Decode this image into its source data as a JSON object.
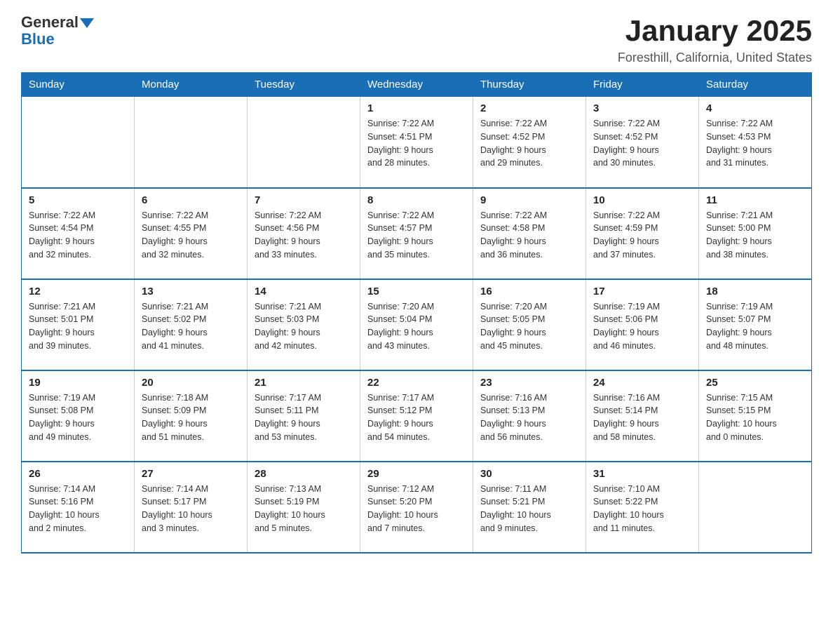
{
  "header": {
    "logo_general": "General",
    "logo_blue": "Blue",
    "month_title": "January 2025",
    "location": "Foresthill, California, United States"
  },
  "days_of_week": [
    "Sunday",
    "Monday",
    "Tuesday",
    "Wednesday",
    "Thursday",
    "Friday",
    "Saturday"
  ],
  "weeks": [
    [
      {
        "day": "",
        "info": ""
      },
      {
        "day": "",
        "info": ""
      },
      {
        "day": "",
        "info": ""
      },
      {
        "day": "1",
        "info": "Sunrise: 7:22 AM\nSunset: 4:51 PM\nDaylight: 9 hours\nand 28 minutes."
      },
      {
        "day": "2",
        "info": "Sunrise: 7:22 AM\nSunset: 4:52 PM\nDaylight: 9 hours\nand 29 minutes."
      },
      {
        "day": "3",
        "info": "Sunrise: 7:22 AM\nSunset: 4:52 PM\nDaylight: 9 hours\nand 30 minutes."
      },
      {
        "day": "4",
        "info": "Sunrise: 7:22 AM\nSunset: 4:53 PM\nDaylight: 9 hours\nand 31 minutes."
      }
    ],
    [
      {
        "day": "5",
        "info": "Sunrise: 7:22 AM\nSunset: 4:54 PM\nDaylight: 9 hours\nand 32 minutes."
      },
      {
        "day": "6",
        "info": "Sunrise: 7:22 AM\nSunset: 4:55 PM\nDaylight: 9 hours\nand 32 minutes."
      },
      {
        "day": "7",
        "info": "Sunrise: 7:22 AM\nSunset: 4:56 PM\nDaylight: 9 hours\nand 33 minutes."
      },
      {
        "day": "8",
        "info": "Sunrise: 7:22 AM\nSunset: 4:57 PM\nDaylight: 9 hours\nand 35 minutes."
      },
      {
        "day": "9",
        "info": "Sunrise: 7:22 AM\nSunset: 4:58 PM\nDaylight: 9 hours\nand 36 minutes."
      },
      {
        "day": "10",
        "info": "Sunrise: 7:22 AM\nSunset: 4:59 PM\nDaylight: 9 hours\nand 37 minutes."
      },
      {
        "day": "11",
        "info": "Sunrise: 7:21 AM\nSunset: 5:00 PM\nDaylight: 9 hours\nand 38 minutes."
      }
    ],
    [
      {
        "day": "12",
        "info": "Sunrise: 7:21 AM\nSunset: 5:01 PM\nDaylight: 9 hours\nand 39 minutes."
      },
      {
        "day": "13",
        "info": "Sunrise: 7:21 AM\nSunset: 5:02 PM\nDaylight: 9 hours\nand 41 minutes."
      },
      {
        "day": "14",
        "info": "Sunrise: 7:21 AM\nSunset: 5:03 PM\nDaylight: 9 hours\nand 42 minutes."
      },
      {
        "day": "15",
        "info": "Sunrise: 7:20 AM\nSunset: 5:04 PM\nDaylight: 9 hours\nand 43 minutes."
      },
      {
        "day": "16",
        "info": "Sunrise: 7:20 AM\nSunset: 5:05 PM\nDaylight: 9 hours\nand 45 minutes."
      },
      {
        "day": "17",
        "info": "Sunrise: 7:19 AM\nSunset: 5:06 PM\nDaylight: 9 hours\nand 46 minutes."
      },
      {
        "day": "18",
        "info": "Sunrise: 7:19 AM\nSunset: 5:07 PM\nDaylight: 9 hours\nand 48 minutes."
      }
    ],
    [
      {
        "day": "19",
        "info": "Sunrise: 7:19 AM\nSunset: 5:08 PM\nDaylight: 9 hours\nand 49 minutes."
      },
      {
        "day": "20",
        "info": "Sunrise: 7:18 AM\nSunset: 5:09 PM\nDaylight: 9 hours\nand 51 minutes."
      },
      {
        "day": "21",
        "info": "Sunrise: 7:17 AM\nSunset: 5:11 PM\nDaylight: 9 hours\nand 53 minutes."
      },
      {
        "day": "22",
        "info": "Sunrise: 7:17 AM\nSunset: 5:12 PM\nDaylight: 9 hours\nand 54 minutes."
      },
      {
        "day": "23",
        "info": "Sunrise: 7:16 AM\nSunset: 5:13 PM\nDaylight: 9 hours\nand 56 minutes."
      },
      {
        "day": "24",
        "info": "Sunrise: 7:16 AM\nSunset: 5:14 PM\nDaylight: 9 hours\nand 58 minutes."
      },
      {
        "day": "25",
        "info": "Sunrise: 7:15 AM\nSunset: 5:15 PM\nDaylight: 10 hours\nand 0 minutes."
      }
    ],
    [
      {
        "day": "26",
        "info": "Sunrise: 7:14 AM\nSunset: 5:16 PM\nDaylight: 10 hours\nand 2 minutes."
      },
      {
        "day": "27",
        "info": "Sunrise: 7:14 AM\nSunset: 5:17 PM\nDaylight: 10 hours\nand 3 minutes."
      },
      {
        "day": "28",
        "info": "Sunrise: 7:13 AM\nSunset: 5:19 PM\nDaylight: 10 hours\nand 5 minutes."
      },
      {
        "day": "29",
        "info": "Sunrise: 7:12 AM\nSunset: 5:20 PM\nDaylight: 10 hours\nand 7 minutes."
      },
      {
        "day": "30",
        "info": "Sunrise: 7:11 AM\nSunset: 5:21 PM\nDaylight: 10 hours\nand 9 minutes."
      },
      {
        "day": "31",
        "info": "Sunrise: 7:10 AM\nSunset: 5:22 PM\nDaylight: 10 hours\nand 11 minutes."
      },
      {
        "day": "",
        "info": ""
      }
    ]
  ]
}
